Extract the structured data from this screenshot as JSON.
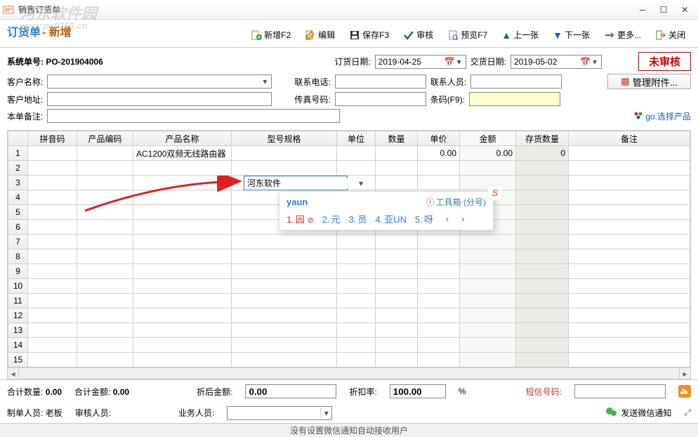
{
  "window": {
    "title": "销售订货单"
  },
  "header": {
    "title": "订货单",
    "sub": " - 新增"
  },
  "watermark": {
    "text1": "河东软件园",
    "text2": "www.pc0359.cn"
  },
  "toolbar": {
    "new": "新增F2",
    "edit": "编辑",
    "save": "保存F3",
    "audit": "审核",
    "preview": "预览F7",
    "prev": "上一张",
    "next": "下一张",
    "more": "更多...",
    "close": "关闭"
  },
  "form": {
    "sysno_label": "系统单号:",
    "sysno_value": "PO-201904006",
    "order_date_label": "订货日期:",
    "order_date": "2019-04-25",
    "delivery_date_label": "交货日期:",
    "delivery_date": "2019-05-02",
    "status": "未审核",
    "cust_name_label": "客户名称:",
    "phone_label": "联系电话:",
    "contact_label": "联系人员:",
    "cust_addr_label": "客户地址:",
    "fax_label": "传真号码:",
    "barcode_label": "条码(F9):",
    "remark_label": "本单备注:",
    "manage_attach": "管理附件...",
    "go_products": "go.选择产品"
  },
  "grid": {
    "cols": [
      "拼音码",
      "产品编码",
      "产品名称",
      "型号规格",
      "单位",
      "数量",
      "单价",
      "金额",
      "存货数量",
      "备注"
    ],
    "rows": [
      {
        "product_name": "AC1200双频无线路由器",
        "price": "0.00",
        "amount": "0.00",
        "stock": "0"
      },
      {},
      {
        "spec_editing": "河东软件"
      },
      {},
      {},
      {},
      {},
      {},
      {},
      {},
      {},
      {},
      {},
      {},
      {}
    ]
  },
  "ime": {
    "pinyin": "yaun",
    "tool": "工具箱 (分号)",
    "cands": [
      "园",
      "元",
      "员",
      "亚UN",
      "呀"
    ]
  },
  "footer": {
    "total_qty_label": "合计数量:",
    "total_qty": "0.00",
    "total_amt_label": "合计金额:",
    "total_amt": "0.00",
    "disc_amt_label": "折后金额:",
    "disc_amt": "0.00",
    "disc_rate_label": "折扣率:",
    "disc_rate": "100.00",
    "pct": "%",
    "sms_label": "短信号码:",
    "maker_label": "制单人员:",
    "maker": "老板",
    "auditor_label": "审核人员:",
    "biz_label": "业务人员:",
    "wechat_btn": "发送微信通知"
  },
  "statusbar": {
    "text": "没有设置微信通知自动接收用户"
  }
}
